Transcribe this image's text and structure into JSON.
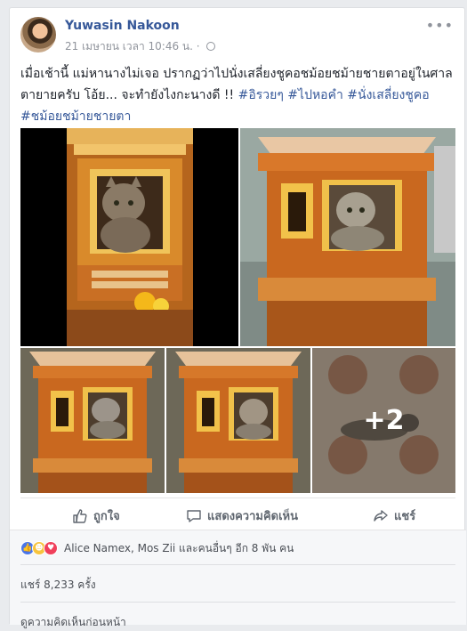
{
  "post": {
    "author": "Yuwasin Nakoon",
    "date_text": "21 เมษายน เวลา 10:46 น.",
    "separator": "·",
    "body_text": "เมื่อเช้านี้ แม่หานางไม่เจอ ปรากฏว่าไปนั่งเสลี่ยงชูคอชม้อยชม้ายชายตาอยู่ในศาลตายายครับ โอ้ย... จะทำยังไงกะนางดี !! ",
    "hashtags": [
      "#อิรวยๆ",
      "#ไปหอคำ",
      "#นั่งเสลี่ยงชูคอ",
      "#ชม้อยชม้ายชายตา"
    ],
    "more_icon": "•••"
  },
  "photos": {
    "more_count": "+2"
  },
  "actions": {
    "like": "ถูกใจ",
    "comment": "แสดงความคิดเห็น",
    "share": "แชร์"
  },
  "reactions": {
    "summary": "Alice Namex, Mos Zii และคนอื่นๆ อีก 8 พัน คน",
    "icons": [
      "like-icon",
      "haha-icon",
      "love-icon"
    ]
  },
  "shares_text": "แชร์ 8,233 ครั้ง",
  "view_previous": "ดูความคิดเห็นก่อนหน้า",
  "colors": {
    "link": "#365899",
    "background": "#e9ebee",
    "like": "#4a76e8",
    "love": "#f0405b",
    "haha": "#f7c43e"
  }
}
